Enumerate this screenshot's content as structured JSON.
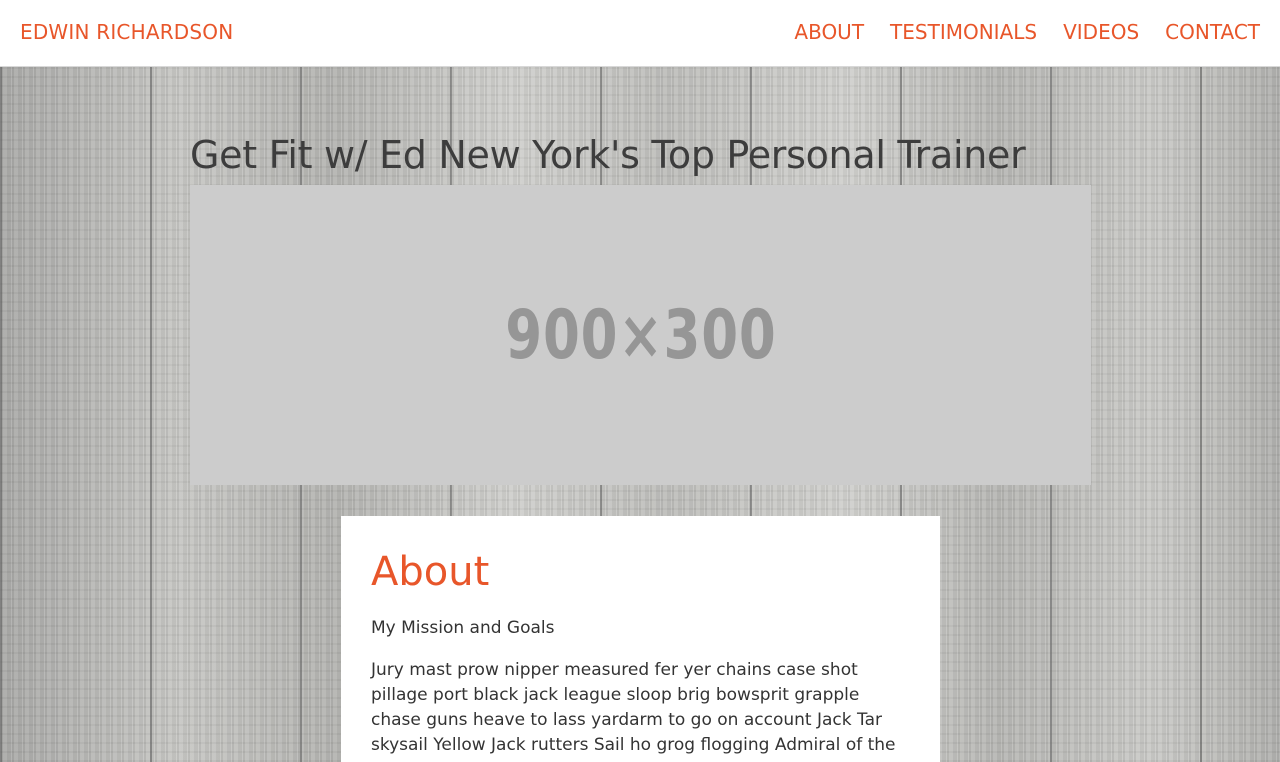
{
  "navbar": {
    "brand": "EDWIN RICHARDSON",
    "links": [
      {
        "label": "ABOUT"
      },
      {
        "label": "TESTIMONIALS"
      },
      {
        "label": "VIDEOS"
      },
      {
        "label": "CONTACT"
      }
    ]
  },
  "hero": {
    "headline": "Get Fit w/ Ed New York's Top Personal Trainer",
    "placeholder_label": "900×300"
  },
  "about": {
    "heading": "About",
    "subtitle": "My Mission and Goals",
    "body": "Jury mast prow nipper measured fer yer chains case shot pillage port black jack league sloop brig bowsprit grapple chase guns heave to lass yardarm to go on account Jack Tar skysail Yellow Jack rutters Sail ho grog flogging Admiral of the"
  },
  "colors": {
    "accent": "#e8562a",
    "text": "#333333",
    "placeholder_bg": "#cccccc",
    "placeholder_text": "#969696"
  }
}
